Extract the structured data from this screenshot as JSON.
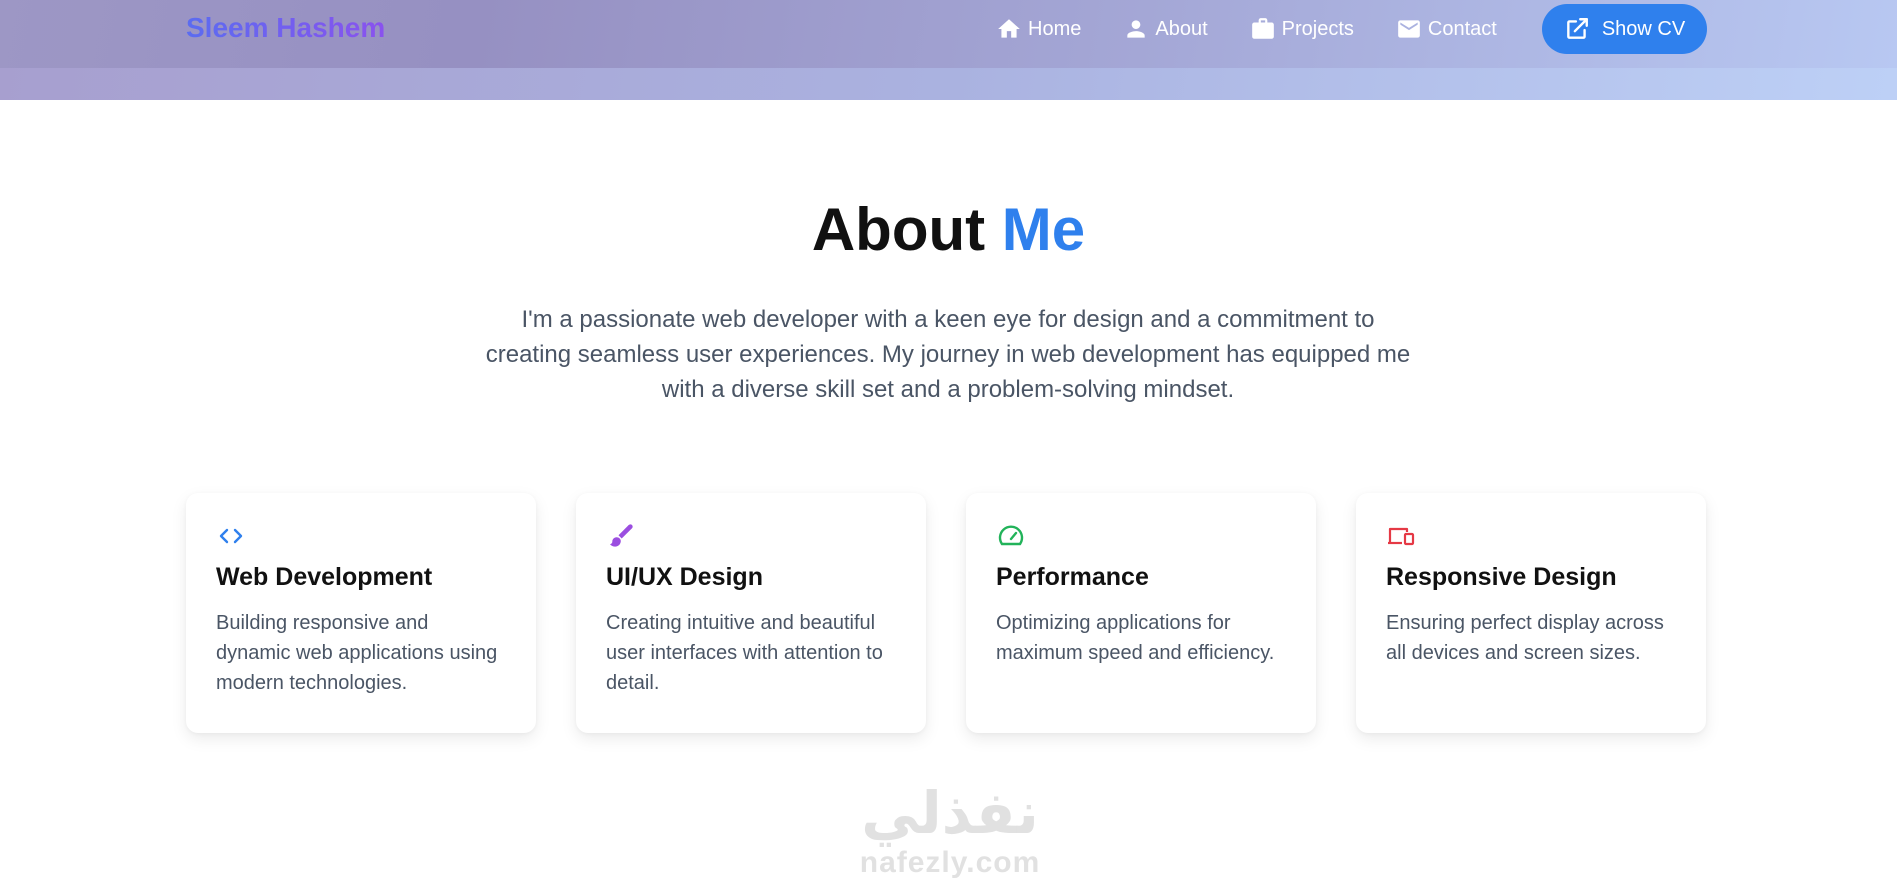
{
  "nav": {
    "brand": "Sleem Hashem",
    "links": [
      {
        "label": "Home",
        "icon": "home-icon"
      },
      {
        "label": "About",
        "icon": "user-icon"
      },
      {
        "label": "Projects",
        "icon": "briefcase-icon"
      },
      {
        "label": "Contact",
        "icon": "mail-icon"
      }
    ],
    "cv_button": {
      "label": "Show CV",
      "icon": "external-link-icon"
    }
  },
  "about": {
    "title_main": "About",
    "title_accent": "Me",
    "intro": "I'm a passionate web developer with a keen eye for design and a commitment to creating seamless user experiences. My journey in web development has equipped me with a diverse skill set and a problem-solving mindset."
  },
  "cards": [
    {
      "icon": "code-icon",
      "color": "#2f80ed",
      "title": "Web Development",
      "description": "Building responsive and dynamic web applications using modern technologies."
    },
    {
      "icon": "brush-icon",
      "color": "#9b4ee0",
      "title": "UI/UX Design",
      "description": "Creating intuitive and beautiful user interfaces with attention to detail."
    },
    {
      "icon": "speedometer-icon",
      "color": "#22b35a",
      "title": "Performance",
      "description": "Optimizing applications for maximum speed and efficiency."
    },
    {
      "icon": "devices-icon",
      "color": "#e53945",
      "title": "Responsive Design",
      "description": "Ensuring perfect display across all devices and screen sizes."
    }
  ],
  "watermark": {
    "arabic": "نفذلي",
    "latin": "nafezly.com"
  },
  "colors": {
    "accent": "#2f80ed",
    "text_muted": "#4a5565"
  }
}
